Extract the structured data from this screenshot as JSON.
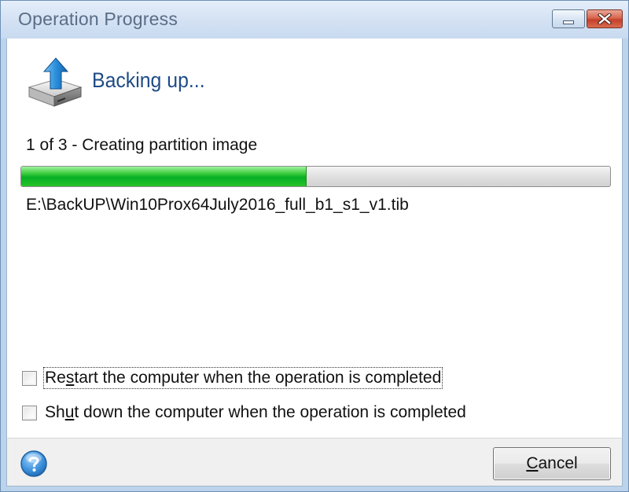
{
  "window": {
    "title": "Operation Progress"
  },
  "header": {
    "icon": "backup-drive-icon",
    "title": "Backing up..."
  },
  "progress": {
    "step_text": "1 of 3 - Creating partition image",
    "fraction": 0.485,
    "fill_color": "#06b025",
    "file_path": "E:\\BackUP\\Win10Prox64July2016_full_b1_s1_v1.tib"
  },
  "options": [
    {
      "label_pre": "Re",
      "label_key": "s",
      "label_post": "tart the computer when the operation is completed",
      "checked": false
    },
    {
      "label_pre": "Sh",
      "label_key": "u",
      "label_post": "t down the computer when the operation is completed",
      "checked": false
    }
  ],
  "footer": {
    "help_icon": "help-icon",
    "cancel_pre": "",
    "cancel_key": "C",
    "cancel_post": "ancel"
  }
}
